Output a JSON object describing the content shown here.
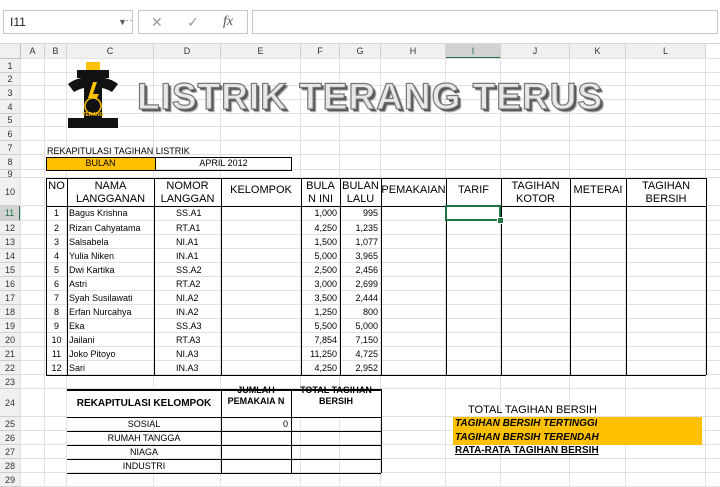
{
  "formula_bar": {
    "name_box": "I11",
    "cancel_icon": "✕",
    "enter_icon": "✓",
    "fx_label": "fx",
    "formula": ""
  },
  "columns": [
    "A",
    "B",
    "C",
    "D",
    "E",
    "F",
    "G",
    "H",
    "I",
    "J",
    "K",
    "L"
  ],
  "selected_column": "I",
  "selected_row": "11",
  "rows": [
    "1",
    "2",
    "3",
    "4",
    "5",
    "6",
    "7",
    "8",
    "9",
    "10",
    "11",
    "12",
    "13",
    "14",
    "15",
    "16",
    "17",
    "18",
    "19",
    "20",
    "21",
    "22",
    "23",
    "24",
    "25",
    "26",
    "27",
    "28",
    "29"
  ],
  "title": "LISTRIK TERANG TERUS",
  "logo_text": "TERANG",
  "recap_title": "REKAPITULASI TAGIHAN LISTRIK",
  "bulan_label": "BULAN",
  "bulan_value": "APRIL 2012",
  "headers": {
    "no": "NO",
    "nama": "NAMA LANGGANAN",
    "nomor": "NOMOR LANGGAN",
    "kelompok": "KELOMPOK",
    "bulan_ini": "BULA N INI",
    "bulan_lalu": "BULAN LALU",
    "pemakaian": "PEMAKAIAN",
    "tarif": "TARIF",
    "tagihan_kotor": "TAGIHAN KOTOR",
    "meterai": "METERAI",
    "tagihan_bersih": "TAGIHAN BERSIH"
  },
  "customers": [
    {
      "no": "1",
      "nama": "Bagus Krishna",
      "nomor": "SS.A1",
      "ini": "1,000",
      "lalu": "995"
    },
    {
      "no": "2",
      "nama": "Rizan Cahyatama",
      "nomor": "RT.A1",
      "ini": "4,250",
      "lalu": "1,235"
    },
    {
      "no": "3",
      "nama": "Salsabela",
      "nomor": "NI.A1",
      "ini": "1,500",
      "lalu": "1,077"
    },
    {
      "no": "4",
      "nama": "Yulia Niken",
      "nomor": "IN.A1",
      "ini": "5,000",
      "lalu": "3,965"
    },
    {
      "no": "5",
      "nama": "Dwi Kartika",
      "nomor": "SS.A2",
      "ini": "2,500",
      "lalu": "2,456"
    },
    {
      "no": "6",
      "nama": "Astri",
      "nomor": "RT.A2",
      "ini": "3,000",
      "lalu": "2,699"
    },
    {
      "no": "7",
      "nama": "Syah Susilawati",
      "nomor": "NI.A2",
      "ini": "3,500",
      "lalu": "2,444"
    },
    {
      "no": "8",
      "nama": "Erfan Nurcahya",
      "nomor": "IN.A2",
      "ini": "1,250",
      "lalu": "800"
    },
    {
      "no": "9",
      "nama": "Eka",
      "nomor": "SS.A3",
      "ini": "5,500",
      "lalu": "5,000"
    },
    {
      "no": "10",
      "nama": "Jailani",
      "nomor": "RT.A3",
      "ini": "7,854",
      "lalu": "7,150"
    },
    {
      "no": "11",
      "nama": "Joko Pitoyo",
      "nomor": "NI.A3",
      "ini": "11,250",
      "lalu": "4,725"
    },
    {
      "no": "12",
      "nama": "Sari",
      "nomor": "IN.A3",
      "ini": "4,250",
      "lalu": "2,952"
    }
  ],
  "recap_group": {
    "title": "REKAPITULASI KELOMPOK",
    "col_jumlah": "JUMLAH PEMAKAIA N",
    "col_total": "TOTAL TAGIHAN BERSIH",
    "groups": [
      {
        "name": "SOSIAL",
        "jumlah": "0"
      },
      {
        "name": "RUMAH TANGGA",
        "jumlah": ""
      },
      {
        "name": "NIAGA",
        "jumlah": ""
      },
      {
        "name": "INDUSTRI",
        "jumlah": ""
      }
    ]
  },
  "summary": {
    "total": "TOTAL TAGIHAN BERSIH",
    "highest": "TAGIHAN BERSIH TERTINGGI",
    "lowest": "TAGIHAN BERSIH TERENDAH",
    "average": "RATA-RATA TAGIHAN BERSIH"
  },
  "colors": {
    "accent": "#ffc000",
    "excel_green": "#217346"
  }
}
